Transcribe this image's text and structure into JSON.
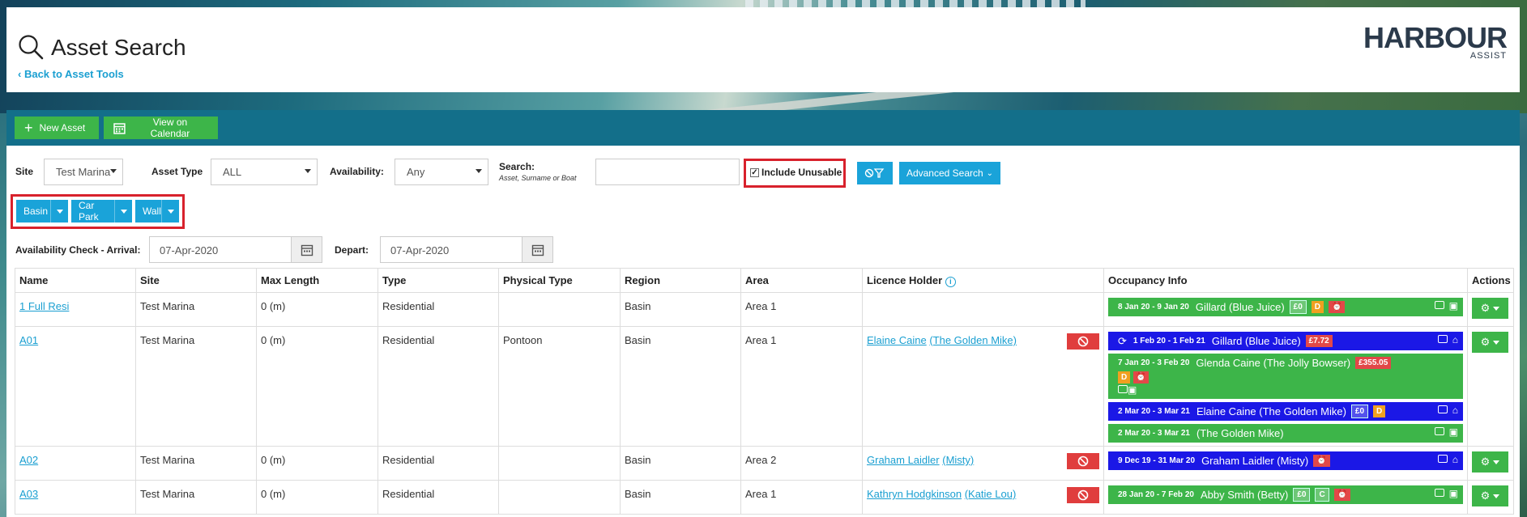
{
  "header": {
    "title": "Asset Search",
    "back_link": "Back to Asset Tools",
    "logo_brand": "HARBOUR",
    "logo_sub": "ASSIST"
  },
  "toolbar": {
    "new_asset": "New Asset",
    "view_calendar": "View on Calendar"
  },
  "filters": {
    "site_label": "Site",
    "site_value": "Test Marina",
    "asset_type_label": "Asset Type",
    "asset_type_value": "ALL",
    "availability_label": "Availability:",
    "availability_value": "Any",
    "search_label": "Search:",
    "search_hint": "Asset, Surname or Boat",
    "search_value": "",
    "include_unusable": "Include Unusable",
    "advanced_search": "Advanced Search",
    "region_buttons": [
      "Basin",
      "Car Park",
      "Wall"
    ],
    "arrival_label": "Availability Check - Arrival:",
    "arrival_value": "07-Apr-2020",
    "depart_label": "Depart:",
    "depart_value": "07-Apr-2020"
  },
  "table": {
    "columns": [
      "Name",
      "Site",
      "Max Length",
      "Type",
      "Physical Type",
      "Region",
      "Area",
      "Licence Holder",
      "Occupancy Info",
      "Actions"
    ],
    "rows": [
      {
        "name": "1 Full Resi",
        "site": "Test Marina",
        "max_length": "0 (m)",
        "type": "Residential",
        "physical_type": "",
        "region": "Basin",
        "area": "Area 1",
        "holder": "",
        "holder_boat": "",
        "occupancy": [
          {
            "color": "green",
            "dates": "8 Jan 20 - 9 Jan 20",
            "text": "Gillard (Blue Juice)",
            "badges": [
              "£0",
              "D"
            ]
          }
        ]
      },
      {
        "name": "A01",
        "site": "Test Marina",
        "max_length": "0 (m)",
        "type": "Residential",
        "physical_type": "Pontoon",
        "region": "Basin",
        "area": "Area 1",
        "holder": "Elaine Caine",
        "holder_boat": "(The Golden Mike)",
        "occupancy": [
          {
            "color": "blue",
            "dates": "1 Feb 20 - 1 Feb 21",
            "text": "Gillard (Blue Juice)",
            "badges": [
              "£7.72"
            ]
          },
          {
            "color": "green",
            "dates": "7 Jan 20 - 3 Feb 20",
            "text": "Glenda Caine (The Jolly Bowser)",
            "badges": [
              "£355.05",
              "D"
            ]
          },
          {
            "color": "blue",
            "dates": "2 Mar 20 - 3 Mar 21",
            "text": "Elaine Caine (The Golden Mike)",
            "badges": [
              "£0",
              "D"
            ]
          },
          {
            "color": "green",
            "dates": "2 Mar 20 - 3 Mar 21",
            "text": "(The Golden Mike)",
            "badges": []
          }
        ]
      },
      {
        "name": "A02",
        "site": "Test Marina",
        "max_length": "0 (m)",
        "type": "Residential",
        "physical_type": "",
        "region": "Basin",
        "area": "Area 2",
        "holder": "Graham Laidler",
        "holder_boat": "(Misty)",
        "occupancy": [
          {
            "color": "blue",
            "dates": "9 Dec 19 - 31 Mar 20",
            "text": "Graham Laidler (Misty)",
            "badges": []
          }
        ]
      },
      {
        "name": "A03",
        "site": "Test Marina",
        "max_length": "0 (m)",
        "type": "Residential",
        "physical_type": "",
        "region": "Basin",
        "area": "Area 1",
        "holder": "Kathryn Hodgkinson",
        "holder_boat": "(Katie Lou)",
        "occupancy": [
          {
            "color": "green",
            "dates": "28 Jan 20 - 7 Feb 20",
            "text": "Abby Smith (Betty)",
            "badges": [
              "£0",
              "C"
            ]
          }
        ]
      }
    ]
  }
}
